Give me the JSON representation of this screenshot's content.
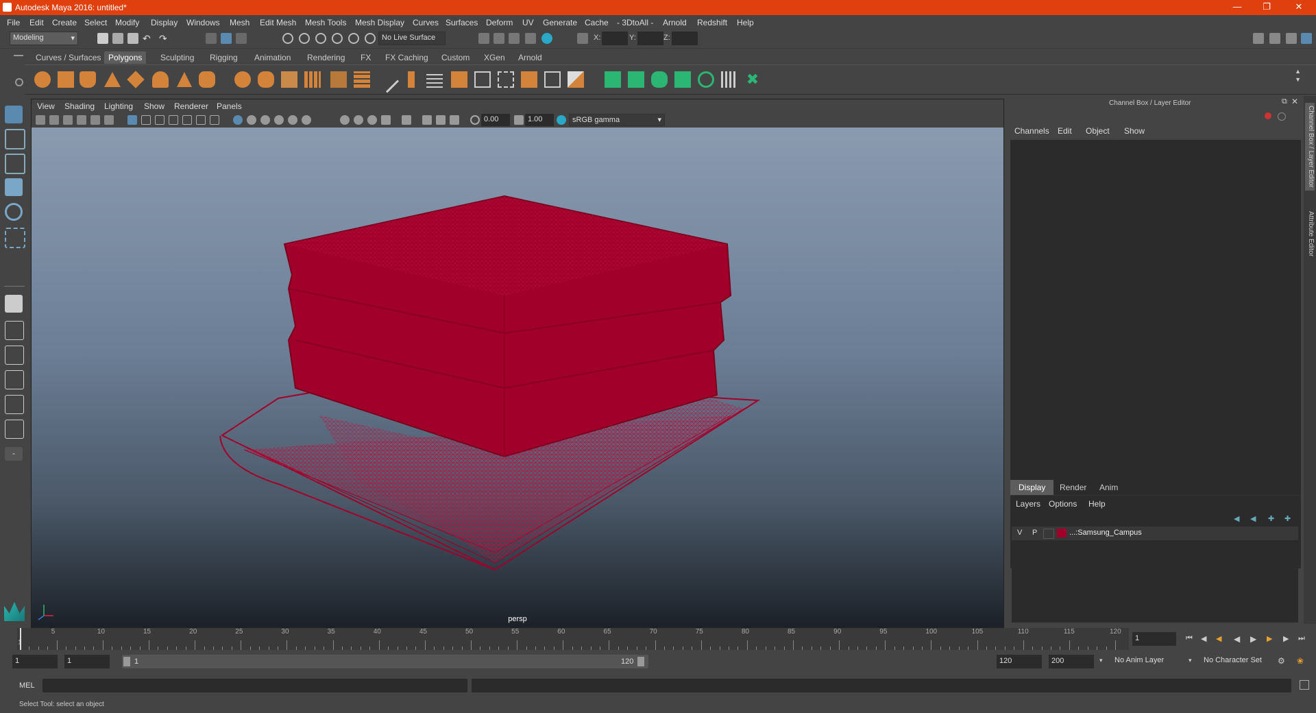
{
  "window": {
    "title": "Autodesk Maya 2016: untitled*"
  },
  "menubar": {
    "items": [
      "File",
      "Edit",
      "Create",
      "Select",
      "Modify",
      "Display",
      "Windows",
      "Mesh",
      "Edit Mesh",
      "Mesh Tools",
      "Mesh Display",
      "Curves",
      "Surfaces",
      "Deform",
      "UV",
      "Generate",
      "Cache",
      "- 3DtoAll -",
      "Arnold",
      "Redshift",
      "Help"
    ]
  },
  "toolbar": {
    "mode": "Modeling",
    "live_surface": "No Live Surface",
    "x_label": "X:",
    "y_label": "Y:",
    "z_label": "Z:"
  },
  "shelf": {
    "tabs": [
      "Curves / Surfaces",
      "Polygons",
      "Sculpting",
      "Rigging",
      "Animation",
      "Rendering",
      "FX",
      "FX Caching",
      "Custom",
      "XGen",
      "Arnold"
    ],
    "active_tab": "Polygons"
  },
  "viewport": {
    "menu": [
      "View",
      "Shading",
      "Lighting",
      "Show",
      "Renderer",
      "Panels"
    ],
    "exposure": "0.00",
    "gamma": "1.00",
    "color_space": "sRGB gamma",
    "camera_label": "persp",
    "mesh_color": "#a0002a"
  },
  "channel_box": {
    "title": "Channel Box / Layer Editor",
    "menu": [
      "Channels",
      "Edit",
      "Object",
      "Show"
    ]
  },
  "layer_editor": {
    "tabs": [
      "Display",
      "Render",
      "Anim"
    ],
    "active_tab": "Display",
    "menu": [
      "Layers",
      "Options",
      "Help"
    ],
    "layers": [
      {
        "v": "V",
        "p": "P",
        "name": "...:Samsung_Campus",
        "color": "#a0002a"
      }
    ]
  },
  "side_tabs": [
    "Channel Box / Layer Editor",
    "Attribute Editor"
  ],
  "timeline": {
    "ticks": [
      5,
      10,
      15,
      20,
      25,
      30,
      35,
      40,
      45,
      50,
      55,
      60,
      65,
      70,
      75,
      80,
      85,
      90,
      95,
      100,
      105,
      110,
      115,
      120
    ],
    "start": "1",
    "current_frame": "1"
  },
  "range": {
    "start": "1",
    "playback_start": "1",
    "slider_start": "1",
    "slider_end": "120",
    "playback_end": "120",
    "end": "200",
    "anim_layer": "No Anim Layer",
    "character_set": "No Character Set"
  },
  "command_line": {
    "label": "MEL"
  },
  "status": {
    "message": "Select Tool: select an object"
  }
}
